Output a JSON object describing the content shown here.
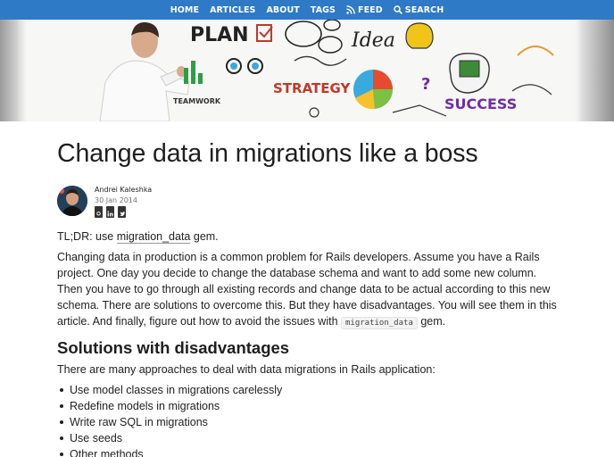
{
  "nav": {
    "items": [
      {
        "label": "HOME",
        "icon": ""
      },
      {
        "label": "ARTICLES",
        "icon": ""
      },
      {
        "label": "ABOUT",
        "icon": ""
      },
      {
        "label": "TAGS",
        "icon": ""
      },
      {
        "label": "FEED",
        "icon": "rss-icon"
      },
      {
        "label": "SEARCH",
        "icon": "search-icon"
      }
    ]
  },
  "hero": {
    "words": {
      "plan": "PLAN",
      "idea": "Idea",
      "strategy": "STRATEGY",
      "success": "SUCCESS",
      "teamwork": "TEAMWORK"
    }
  },
  "post": {
    "title": "Change data in migrations like a boss",
    "author": "Andrei Kaleshka",
    "date": "30 Jan 2014",
    "social_icons": [
      "github-icon",
      "linkedin-icon",
      "twitter-icon"
    ],
    "tldr_prefix": "TL;DR: use ",
    "tldr_link": "migration_data",
    "tldr_suffix": " gem.",
    "paragraph_main": "Changing data in production is a common problem for Rails developers. Assume you have a Rails project. One day you decide to change the database schema and want to add some new column. Then you have to go through all existing records and change data to be actual according to this new schema. There are solutions to overcome this. But they have disadvantages. You will see them in this article. And finally, figure out how to avoid the issues with ",
    "paragraph_code": "migration_data",
    "paragraph_end": " gem.",
    "section_heading": "Solutions with disadvantages",
    "section_intro": "There are many approaches to deal with data migrations in Rails application:",
    "list": [
      "Use model classes in migrations carelessly",
      "Redefine models in migrations",
      "Write raw SQL in migrations",
      "Use seeds",
      "Other methods"
    ]
  }
}
